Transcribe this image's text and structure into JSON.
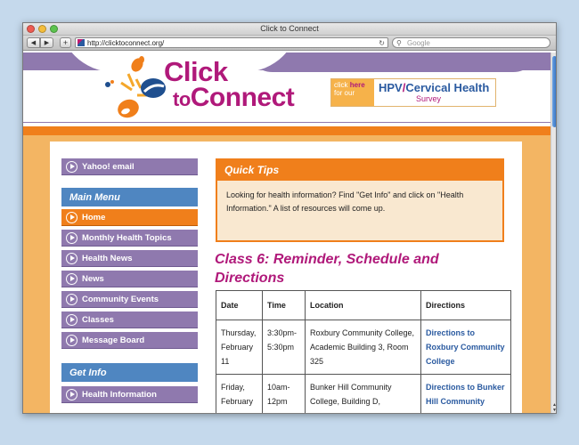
{
  "window": {
    "title": "Click to Connect"
  },
  "toolbar": {
    "back_label": "◀",
    "forward_label": "▶",
    "new_tab_label": "+",
    "url": "http://clicktoconnect.org/",
    "reload_label": "↻",
    "search_placeholder": "Google"
  },
  "header": {
    "logo_line1": "Click",
    "logo_to": "to",
    "logo_line2": "Connect",
    "banner_click": "click",
    "banner_here": "here",
    "banner_for_our": "for our",
    "banner_hpv": "HPV",
    "banner_slash": "/",
    "banner_cervical": "Cervical Health",
    "banner_survey": "Survey"
  },
  "sidebar": {
    "yahoo_email": "Yahoo! email",
    "main_menu_heading": "Main Menu",
    "main_menu": [
      {
        "label": "Home",
        "active": true
      },
      {
        "label": "Monthly Health Topics"
      },
      {
        "label": "Health News"
      },
      {
        "label": "News"
      },
      {
        "label": "Community Events"
      },
      {
        "label": "Classes"
      },
      {
        "label": "Message Board"
      }
    ],
    "get_info_heading": "Get Info",
    "get_info": [
      {
        "label": "Health Information"
      }
    ]
  },
  "quick_tips": {
    "heading": "Quick Tips",
    "body": "Looking for health information? Find \"Get Info\" and click on \"Health Information.\" A list of resources will come up."
  },
  "main": {
    "title": "Class 6: Reminder, Schedule and Directions",
    "table": {
      "headers": [
        "Date",
        "Time",
        "Location",
        "Directions"
      ],
      "rows": [
        [
          "Thursday, February 11",
          "3:30pm-5:30pm",
          "Roxbury Community College, Academic Building 3, Room 325",
          "Directions to Roxbury Community College"
        ],
        [
          "Friday, February",
          "10am-12pm",
          "Bunker Hill Community College, Building D,",
          "Directions to Bunker Hill Community"
        ]
      ]
    }
  },
  "colors": {
    "purple": "#8f79ae",
    "orange": "#f07f1b",
    "magenta": "#b0197a",
    "blue": "#4f86c1",
    "page_bg": "#f3b563"
  }
}
